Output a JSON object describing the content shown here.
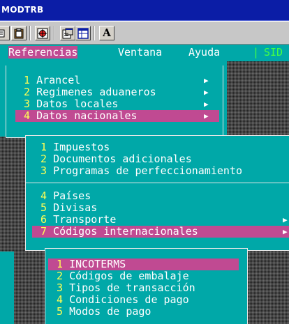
{
  "window": {
    "title": "MODTRB"
  },
  "toolbar": {
    "buttons": [
      {
        "name": "paste-icon"
      },
      {
        "name": "clipboard-icon"
      },
      {
        "name": "target-icon"
      },
      {
        "name": "properties-icon"
      },
      {
        "name": "window-icon"
      },
      {
        "name": "font-icon",
        "letter": "A"
      }
    ]
  },
  "menubar": {
    "items": [
      {
        "label": "Referencias",
        "active": true
      },
      {
        "label": "Ventana"
      },
      {
        "label": "Ayuda"
      }
    ],
    "separator": "|",
    "right_label": "SID"
  },
  "menu1": {
    "items": [
      {
        "num": "1",
        "label": "Arancel",
        "submenu": true
      },
      {
        "num": "2",
        "label": "Regimenes aduaneros",
        "submenu": true
      },
      {
        "num": "3",
        "label": "Datos locales",
        "submenu": true
      },
      {
        "num": "4",
        "label": "Datos nacionales",
        "submenu": true,
        "selected": true
      }
    ]
  },
  "menu2": {
    "items": [
      {
        "num": "1",
        "label": "Impuestos"
      },
      {
        "num": "2",
        "label": "Documentos adicionales"
      },
      {
        "num": "3",
        "label": "Programas de perfeccionamiento"
      },
      {
        "num": "4",
        "label": "Países"
      },
      {
        "num": "5",
        "label": "Divisas"
      },
      {
        "num": "6",
        "label": "Transporte",
        "submenu": true
      },
      {
        "num": "7",
        "label": "Códigos internacionales",
        "submenu": true,
        "selected": true
      }
    ]
  },
  "menu3": {
    "items": [
      {
        "num": "1",
        "label": "INCOTERMS",
        "selected": true
      },
      {
        "num": "2",
        "label": "Códigos de embalaje"
      },
      {
        "num": "3",
        "label": "Tipos de transacción"
      },
      {
        "num": "4",
        "label": "Condiciones de pago"
      },
      {
        "num": "5",
        "label": "Modos de pago"
      }
    ]
  },
  "glyphs": {
    "submenu_arrow": "▶"
  },
  "colors": {
    "title_bar": "#0b1da6",
    "screen_bg": "#00a8a8",
    "highlight": "#c04a92",
    "number": "#ffff55",
    "status_green": "#44ff44"
  }
}
